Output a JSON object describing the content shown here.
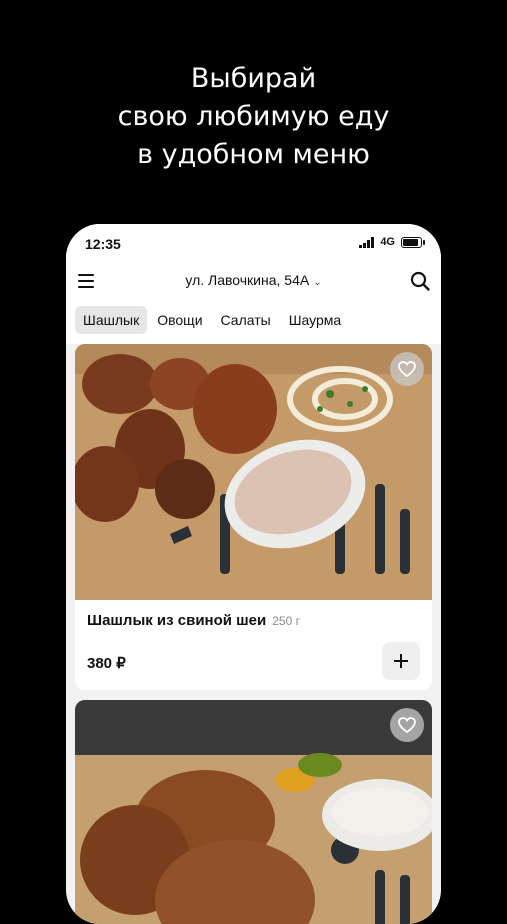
{
  "promo": {
    "line1": "Выбирай",
    "line2": "свою любимую еду",
    "line3": "в удобном меню"
  },
  "status_bar": {
    "time": "12:35",
    "network": "4G"
  },
  "header": {
    "address": "ул. Лавочкина, 54А",
    "menu_icon": "hamburger-menu-icon",
    "search_icon": "search-icon"
  },
  "categories": [
    {
      "label": "Шашлык",
      "active": true
    },
    {
      "label": "Овощи",
      "active": false
    },
    {
      "label": "Салаты",
      "active": false
    },
    {
      "label": "Шаурма",
      "active": false
    }
  ],
  "products": [
    {
      "name": "Шашлык из свиной шеи",
      "weight": "250 г",
      "price": "380 ₽",
      "add_label": "+",
      "favorite_icon": "heart-icon"
    },
    {
      "favorite_icon": "heart-icon"
    }
  ],
  "colors": {
    "page_background": "#000000",
    "app_background": "#f2f2f2",
    "active_tab": "#e6e6e6",
    "muted_text": "#8a8a8a"
  }
}
